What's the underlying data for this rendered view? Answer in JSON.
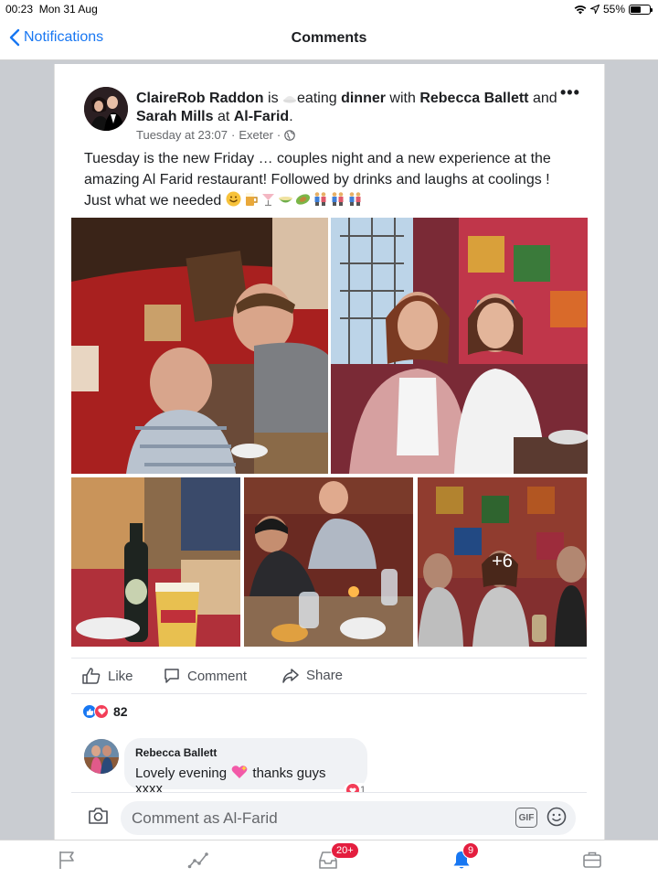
{
  "status_bar": {
    "time": "00:23",
    "date": "Mon 31 Aug",
    "battery": "55%",
    "battery_level": 0.55
  },
  "nav": {
    "back_label": "Notifications",
    "title": "Comments"
  },
  "post": {
    "author": "ClaireRob Raddon",
    "is_word": "is",
    "activity_verb": "eating",
    "activity_object": "dinner",
    "with_word": "with",
    "tag_1": "Rebecca Ballett",
    "and_word": "and",
    "tag_2": "Sarah Mills",
    "at_word": "at",
    "place": "Al-Farid",
    "timestamp": "Tuesday at 23:07",
    "location": "Exeter",
    "text": "Tuesday is the new Friday … couples night and a new experience at the amazing Al Farid restaurant! Followed by drinks and laughs at coolings ! Just what we needed",
    "more_photos": "+6"
  },
  "actions": {
    "like": "Like",
    "comment": "Comment",
    "share": "Share"
  },
  "reactions": {
    "count": "82"
  },
  "comment": {
    "author": "Rebecca Ballett",
    "text": "Lovely evening",
    "text_suffix": "thanks guys xxxx",
    "reaction_count": "1"
  },
  "composer": {
    "placeholder": "Comment as Al-Farid",
    "gif_label": "GIF"
  },
  "tabs": {
    "inbox_badge": "20+",
    "notifications_badge": "9"
  },
  "colors": {
    "accent": "#1877f2",
    "badge": "#e41e3f"
  }
}
